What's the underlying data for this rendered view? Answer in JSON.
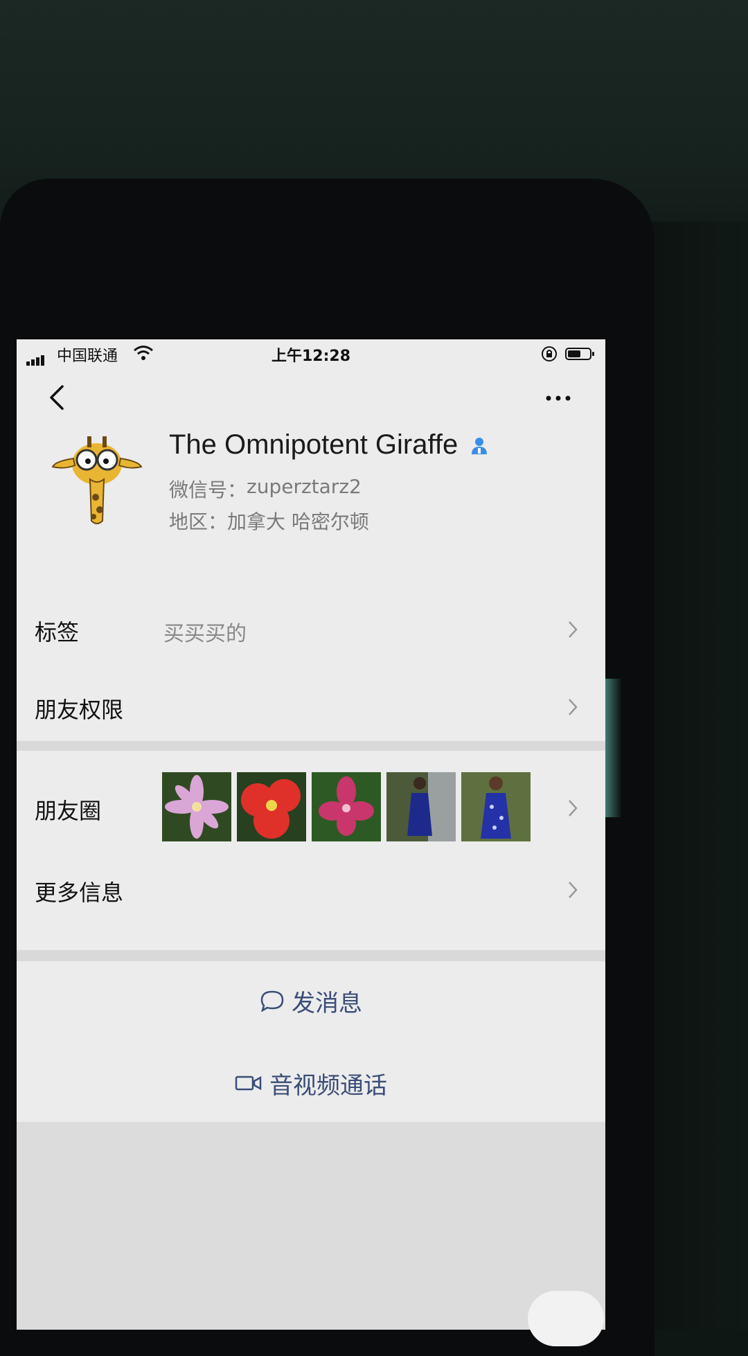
{
  "status_bar": {
    "carrier": "中国联通",
    "time": "上午12:28"
  },
  "profile": {
    "name": "The Omnipotent Giraffe",
    "wechat_id_label": "微信号：",
    "wechat_id": "zuperztarz2",
    "region_label": "地区：",
    "region": "加拿大 哈密尔顿"
  },
  "rows": {
    "tags_label": "标签",
    "tags_value": "买买买的",
    "permissions_label": "朋友权限",
    "moments_label": "朋友圈",
    "more_info_label": "更多信息"
  },
  "actions": {
    "send_message": "发消息",
    "video_call": "音视频通话"
  },
  "icons": [
    "signal-icon",
    "wifi-icon",
    "rotation-lock-icon",
    "battery-icon",
    "back-icon",
    "more-icon",
    "contact-badge-icon",
    "chevron-right-icon",
    "chat-bubble-icon",
    "video-camera-icon"
  ],
  "colors": {
    "accent_text": "#3a4d78",
    "badge_blue": "#3a8ee6",
    "background": "#ececec"
  }
}
